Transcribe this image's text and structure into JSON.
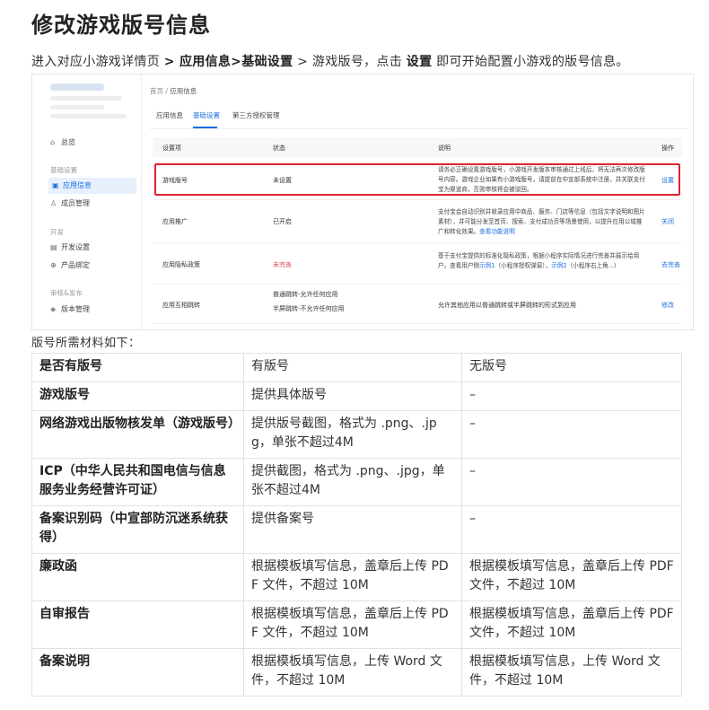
{
  "page_title": "修改游戏版号信息",
  "intro": {
    "prefix": "进入对应小游戏详情页 ",
    "arrow1": "> ",
    "path": "应用信息>基础设置",
    "arrow2": " > 游戏版号，点击 ",
    "action": "设置",
    "suffix": " 即可开始配置小游戏的版号信息。"
  },
  "screenshot": {
    "sidebar": {
      "home": "总览",
      "group_basic": "基础设置",
      "app_info": "应用信息",
      "members": "成员管理",
      "group_dev": "开发",
      "dev_settings": "开发设置",
      "product_bind": "产品绑定",
      "group_review": "审核&发布",
      "version_mgmt": "版本管理"
    },
    "breadcrumb": {
      "home": "首页",
      "sep": "/",
      "current": "应用信息"
    },
    "tabs": [
      "应用信息",
      "基础设置",
      "第三方授权管理"
    ],
    "columns": [
      "设置项",
      "状态",
      "说明",
      "操作"
    ],
    "rows": [
      {
        "name": "游戏版号",
        "status": "未设置",
        "desc": "请务必正确设置游戏版号，小游戏开发版本审核通过上线后，将无法再次修改版号内容。游戏企业如果有小游戏版号，请提前在中宣部系统中注册，并关联支付宝为渠道商，否则审核将会被驳回。",
        "action": "设置"
      },
      {
        "name": "应用推广",
        "status": "已开启",
        "desc": "支付宝会自动识别并收录应用中商品、服务、门店等信息（包括文字说明和图片素材），并可能分发至首页、搜索、支付成功页等场景使用，以提升应用公域推广和转化效果。",
        "desc_link": "查看功能说明",
        "action": "关闭"
      },
      {
        "name": "应用隐私政策",
        "status": "未完善",
        "desc": "基于支付宝提供的标准化隐私政策，根据小程序实际情况进行完善并展示给用户。查看用户侧",
        "desc_link1": "示例1",
        "desc_mid": "（小程序授权弹窗），",
        "desc_link2": "示例2",
        "desc_end": "（小程序右上角...）",
        "action": "去完善"
      },
      {
        "name": "应用互相跳转",
        "status1": "普通跳转-允许任何应用",
        "status2": "半屏跳转-不允许任何应用",
        "desc": "允许其他应用以普通跳转或半屏跳转的形式到应用",
        "action": "修改"
      }
    ]
  },
  "materials_title": "版号所需材料如下：",
  "table": {
    "header": [
      "是否有版号",
      "有版号",
      "无版号"
    ],
    "rows": [
      [
        "游戏版号",
        "提供具体版号",
        "–"
      ],
      [
        "网络游戏出版物核发单（游戏版号）",
        "提供版号截图，格式为 .png、.jpg，单张不超过4M",
        "–"
      ],
      [
        "ICP（中华人民共和国电信与信息服务业务经营许可证）",
        "提供截图，格式为 .png、.jpg，单张不超过4M",
        "–"
      ],
      [
        "备案识别码（中宣部防沉迷系统获得）",
        "提供备案号",
        "–"
      ],
      [
        "廉政函",
        "根据模板填写信息，盖章后上传 PDF 文件，不超过 10M",
        "根据模板填写信息，盖章后上传 PDF 文件，不超过 10M"
      ],
      [
        "自审报告",
        "根据模板填写信息，盖章后上传 PDF 文件，不超过 10M",
        "根据模板填写信息，盖章后上传 PDF 文件，不超过 10M"
      ],
      [
        "备案说明",
        "根据模板填写信息，上传 Word 文件，不超过 10M",
        "根据模板填写信息，上传 Word 文件，不超过 10M"
      ]
    ]
  }
}
